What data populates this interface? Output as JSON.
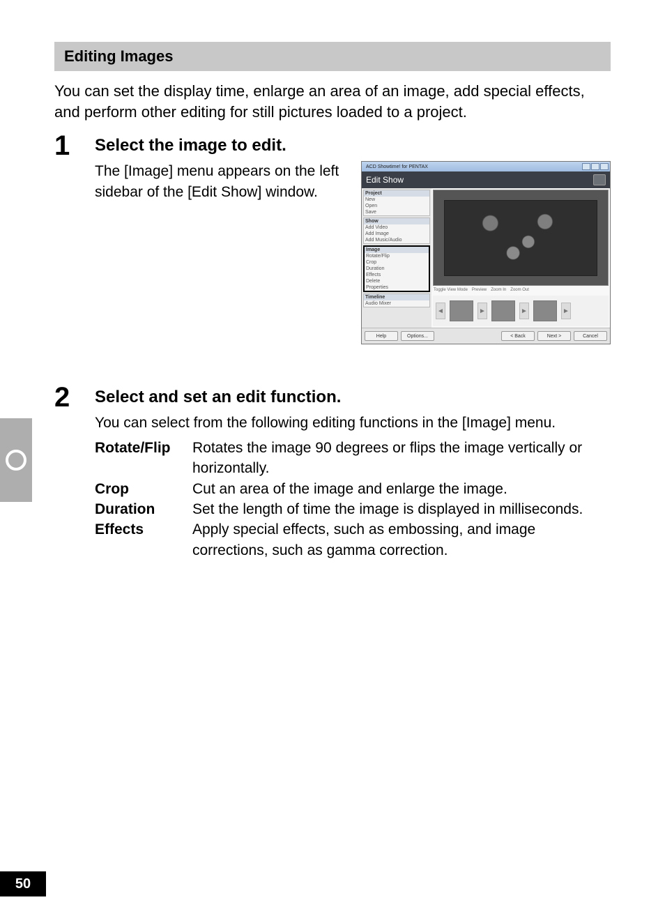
{
  "section_header": "Editing Images",
  "intro": "You can set the display time, enlarge an area of an image, add special effects, and perform other editing for still pictures loaded to a project.",
  "steps": {
    "s1": {
      "num": "1",
      "title": "Select the image to edit.",
      "desc": "The [Image] menu appears on the left sidebar of the [Edit Show] window."
    },
    "s2": {
      "num": "2",
      "title": "Select and set an edit function.",
      "desc": "You can select from the following editing functions in the [Image] menu."
    }
  },
  "defs": [
    {
      "term": "Rotate/Flip",
      "desc": "Rotates the image 90 degrees or flips the image vertically or horizontally."
    },
    {
      "term": "Crop",
      "desc": "Cut an area of the image and enlarge the image."
    },
    {
      "term": "Duration",
      "desc": "Set the length of time the image is displayed in milliseconds."
    },
    {
      "term": "Effects",
      "desc": "Apply special effects, such as embossing, and image corrections, such as gamma correction."
    }
  ],
  "page_number": "50",
  "shot": {
    "titlebar": "ACD Showtime! for PENTAX",
    "header": "Edit Show",
    "sidebar": {
      "project": {
        "label": "Project",
        "items": [
          "New",
          "Open",
          "Save"
        ]
      },
      "show": {
        "label": "Show",
        "items": [
          "Add Video",
          "Add Image",
          "Add Music/Audio"
        ]
      },
      "image": {
        "label": "Image",
        "items": [
          "Rotate/Flip",
          "Crop",
          "Duration",
          "Effects",
          "Delete",
          "Properties"
        ]
      },
      "timeline": {
        "label": "Timeline",
        "items": [
          "Audio Mixer"
        ]
      }
    },
    "prev_toolbar": [
      "Toggle View Mode",
      "Preview",
      "Zoom In",
      "Zoom Out"
    ],
    "footer": {
      "help": "Help",
      "options": "Options...",
      "back": "< Back",
      "next": "Next >",
      "cancel": "Cancel"
    }
  }
}
